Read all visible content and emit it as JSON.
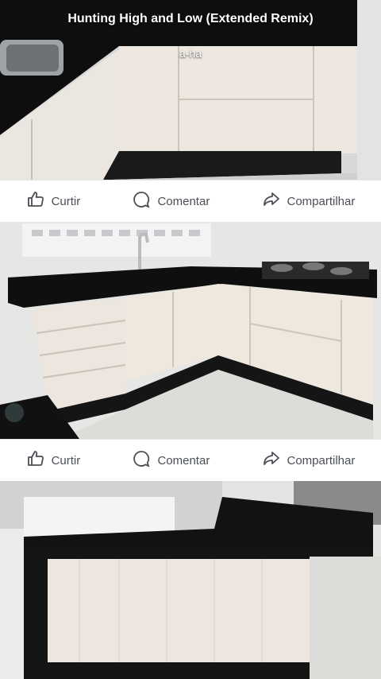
{
  "music": {
    "title": "Hunting High and Low (Extended Remix)",
    "artist": "a-ha"
  },
  "actions": {
    "like": "Curtir",
    "comment": "Comentar",
    "share": "Compartilhar"
  },
  "colors": {
    "action_text": "#4b4f56",
    "divider": "#e6e6e6"
  },
  "icons": [
    "thumbs-up-icon",
    "comment-bubble-icon",
    "share-arrow-icon"
  ]
}
